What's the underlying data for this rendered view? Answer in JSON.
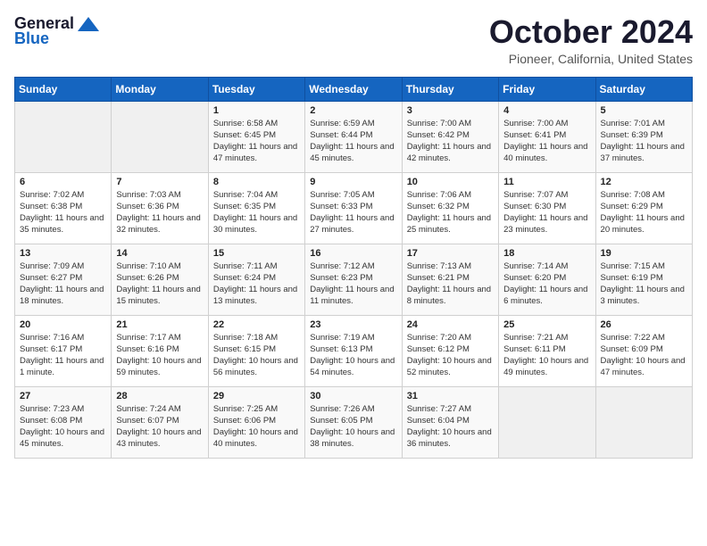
{
  "logo": {
    "general": "General",
    "blue": "Blue"
  },
  "title": "October 2024",
  "subtitle": "Pioneer, California, United States",
  "weekdays": [
    "Sunday",
    "Monday",
    "Tuesday",
    "Wednesday",
    "Thursday",
    "Friday",
    "Saturday"
  ],
  "weeks": [
    [
      {
        "day": "",
        "empty": true
      },
      {
        "day": "",
        "empty": true
      },
      {
        "day": "1",
        "sunrise": "Sunrise: 6:58 AM",
        "sunset": "Sunset: 6:45 PM",
        "daylight": "Daylight: 11 hours and 47 minutes."
      },
      {
        "day": "2",
        "sunrise": "Sunrise: 6:59 AM",
        "sunset": "Sunset: 6:44 PM",
        "daylight": "Daylight: 11 hours and 45 minutes."
      },
      {
        "day": "3",
        "sunrise": "Sunrise: 7:00 AM",
        "sunset": "Sunset: 6:42 PM",
        "daylight": "Daylight: 11 hours and 42 minutes."
      },
      {
        "day": "4",
        "sunrise": "Sunrise: 7:00 AM",
        "sunset": "Sunset: 6:41 PM",
        "daylight": "Daylight: 11 hours and 40 minutes."
      },
      {
        "day": "5",
        "sunrise": "Sunrise: 7:01 AM",
        "sunset": "Sunset: 6:39 PM",
        "daylight": "Daylight: 11 hours and 37 minutes."
      }
    ],
    [
      {
        "day": "6",
        "sunrise": "Sunrise: 7:02 AM",
        "sunset": "Sunset: 6:38 PM",
        "daylight": "Daylight: 11 hours and 35 minutes."
      },
      {
        "day": "7",
        "sunrise": "Sunrise: 7:03 AM",
        "sunset": "Sunset: 6:36 PM",
        "daylight": "Daylight: 11 hours and 32 minutes."
      },
      {
        "day": "8",
        "sunrise": "Sunrise: 7:04 AM",
        "sunset": "Sunset: 6:35 PM",
        "daylight": "Daylight: 11 hours and 30 minutes."
      },
      {
        "day": "9",
        "sunrise": "Sunrise: 7:05 AM",
        "sunset": "Sunset: 6:33 PM",
        "daylight": "Daylight: 11 hours and 27 minutes."
      },
      {
        "day": "10",
        "sunrise": "Sunrise: 7:06 AM",
        "sunset": "Sunset: 6:32 PM",
        "daylight": "Daylight: 11 hours and 25 minutes."
      },
      {
        "day": "11",
        "sunrise": "Sunrise: 7:07 AM",
        "sunset": "Sunset: 6:30 PM",
        "daylight": "Daylight: 11 hours and 23 minutes."
      },
      {
        "day": "12",
        "sunrise": "Sunrise: 7:08 AM",
        "sunset": "Sunset: 6:29 PM",
        "daylight": "Daylight: 11 hours and 20 minutes."
      }
    ],
    [
      {
        "day": "13",
        "sunrise": "Sunrise: 7:09 AM",
        "sunset": "Sunset: 6:27 PM",
        "daylight": "Daylight: 11 hours and 18 minutes."
      },
      {
        "day": "14",
        "sunrise": "Sunrise: 7:10 AM",
        "sunset": "Sunset: 6:26 PM",
        "daylight": "Daylight: 11 hours and 15 minutes."
      },
      {
        "day": "15",
        "sunrise": "Sunrise: 7:11 AM",
        "sunset": "Sunset: 6:24 PM",
        "daylight": "Daylight: 11 hours and 13 minutes."
      },
      {
        "day": "16",
        "sunrise": "Sunrise: 7:12 AM",
        "sunset": "Sunset: 6:23 PM",
        "daylight": "Daylight: 11 hours and 11 minutes."
      },
      {
        "day": "17",
        "sunrise": "Sunrise: 7:13 AM",
        "sunset": "Sunset: 6:21 PM",
        "daylight": "Daylight: 11 hours and 8 minutes."
      },
      {
        "day": "18",
        "sunrise": "Sunrise: 7:14 AM",
        "sunset": "Sunset: 6:20 PM",
        "daylight": "Daylight: 11 hours and 6 minutes."
      },
      {
        "day": "19",
        "sunrise": "Sunrise: 7:15 AM",
        "sunset": "Sunset: 6:19 PM",
        "daylight": "Daylight: 11 hours and 3 minutes."
      }
    ],
    [
      {
        "day": "20",
        "sunrise": "Sunrise: 7:16 AM",
        "sunset": "Sunset: 6:17 PM",
        "daylight": "Daylight: 11 hours and 1 minute."
      },
      {
        "day": "21",
        "sunrise": "Sunrise: 7:17 AM",
        "sunset": "Sunset: 6:16 PM",
        "daylight": "Daylight: 10 hours and 59 minutes."
      },
      {
        "day": "22",
        "sunrise": "Sunrise: 7:18 AM",
        "sunset": "Sunset: 6:15 PM",
        "daylight": "Daylight: 10 hours and 56 minutes."
      },
      {
        "day": "23",
        "sunrise": "Sunrise: 7:19 AM",
        "sunset": "Sunset: 6:13 PM",
        "daylight": "Daylight: 10 hours and 54 minutes."
      },
      {
        "day": "24",
        "sunrise": "Sunrise: 7:20 AM",
        "sunset": "Sunset: 6:12 PM",
        "daylight": "Daylight: 10 hours and 52 minutes."
      },
      {
        "day": "25",
        "sunrise": "Sunrise: 7:21 AM",
        "sunset": "Sunset: 6:11 PM",
        "daylight": "Daylight: 10 hours and 49 minutes."
      },
      {
        "day": "26",
        "sunrise": "Sunrise: 7:22 AM",
        "sunset": "Sunset: 6:09 PM",
        "daylight": "Daylight: 10 hours and 47 minutes."
      }
    ],
    [
      {
        "day": "27",
        "sunrise": "Sunrise: 7:23 AM",
        "sunset": "Sunset: 6:08 PM",
        "daylight": "Daylight: 10 hours and 45 minutes."
      },
      {
        "day": "28",
        "sunrise": "Sunrise: 7:24 AM",
        "sunset": "Sunset: 6:07 PM",
        "daylight": "Daylight: 10 hours and 43 minutes."
      },
      {
        "day": "29",
        "sunrise": "Sunrise: 7:25 AM",
        "sunset": "Sunset: 6:06 PM",
        "daylight": "Daylight: 10 hours and 40 minutes."
      },
      {
        "day": "30",
        "sunrise": "Sunrise: 7:26 AM",
        "sunset": "Sunset: 6:05 PM",
        "daylight": "Daylight: 10 hours and 38 minutes."
      },
      {
        "day": "31",
        "sunrise": "Sunrise: 7:27 AM",
        "sunset": "Sunset: 6:04 PM",
        "daylight": "Daylight: 10 hours and 36 minutes."
      },
      {
        "day": "",
        "empty": true
      },
      {
        "day": "",
        "empty": true
      }
    ]
  ]
}
